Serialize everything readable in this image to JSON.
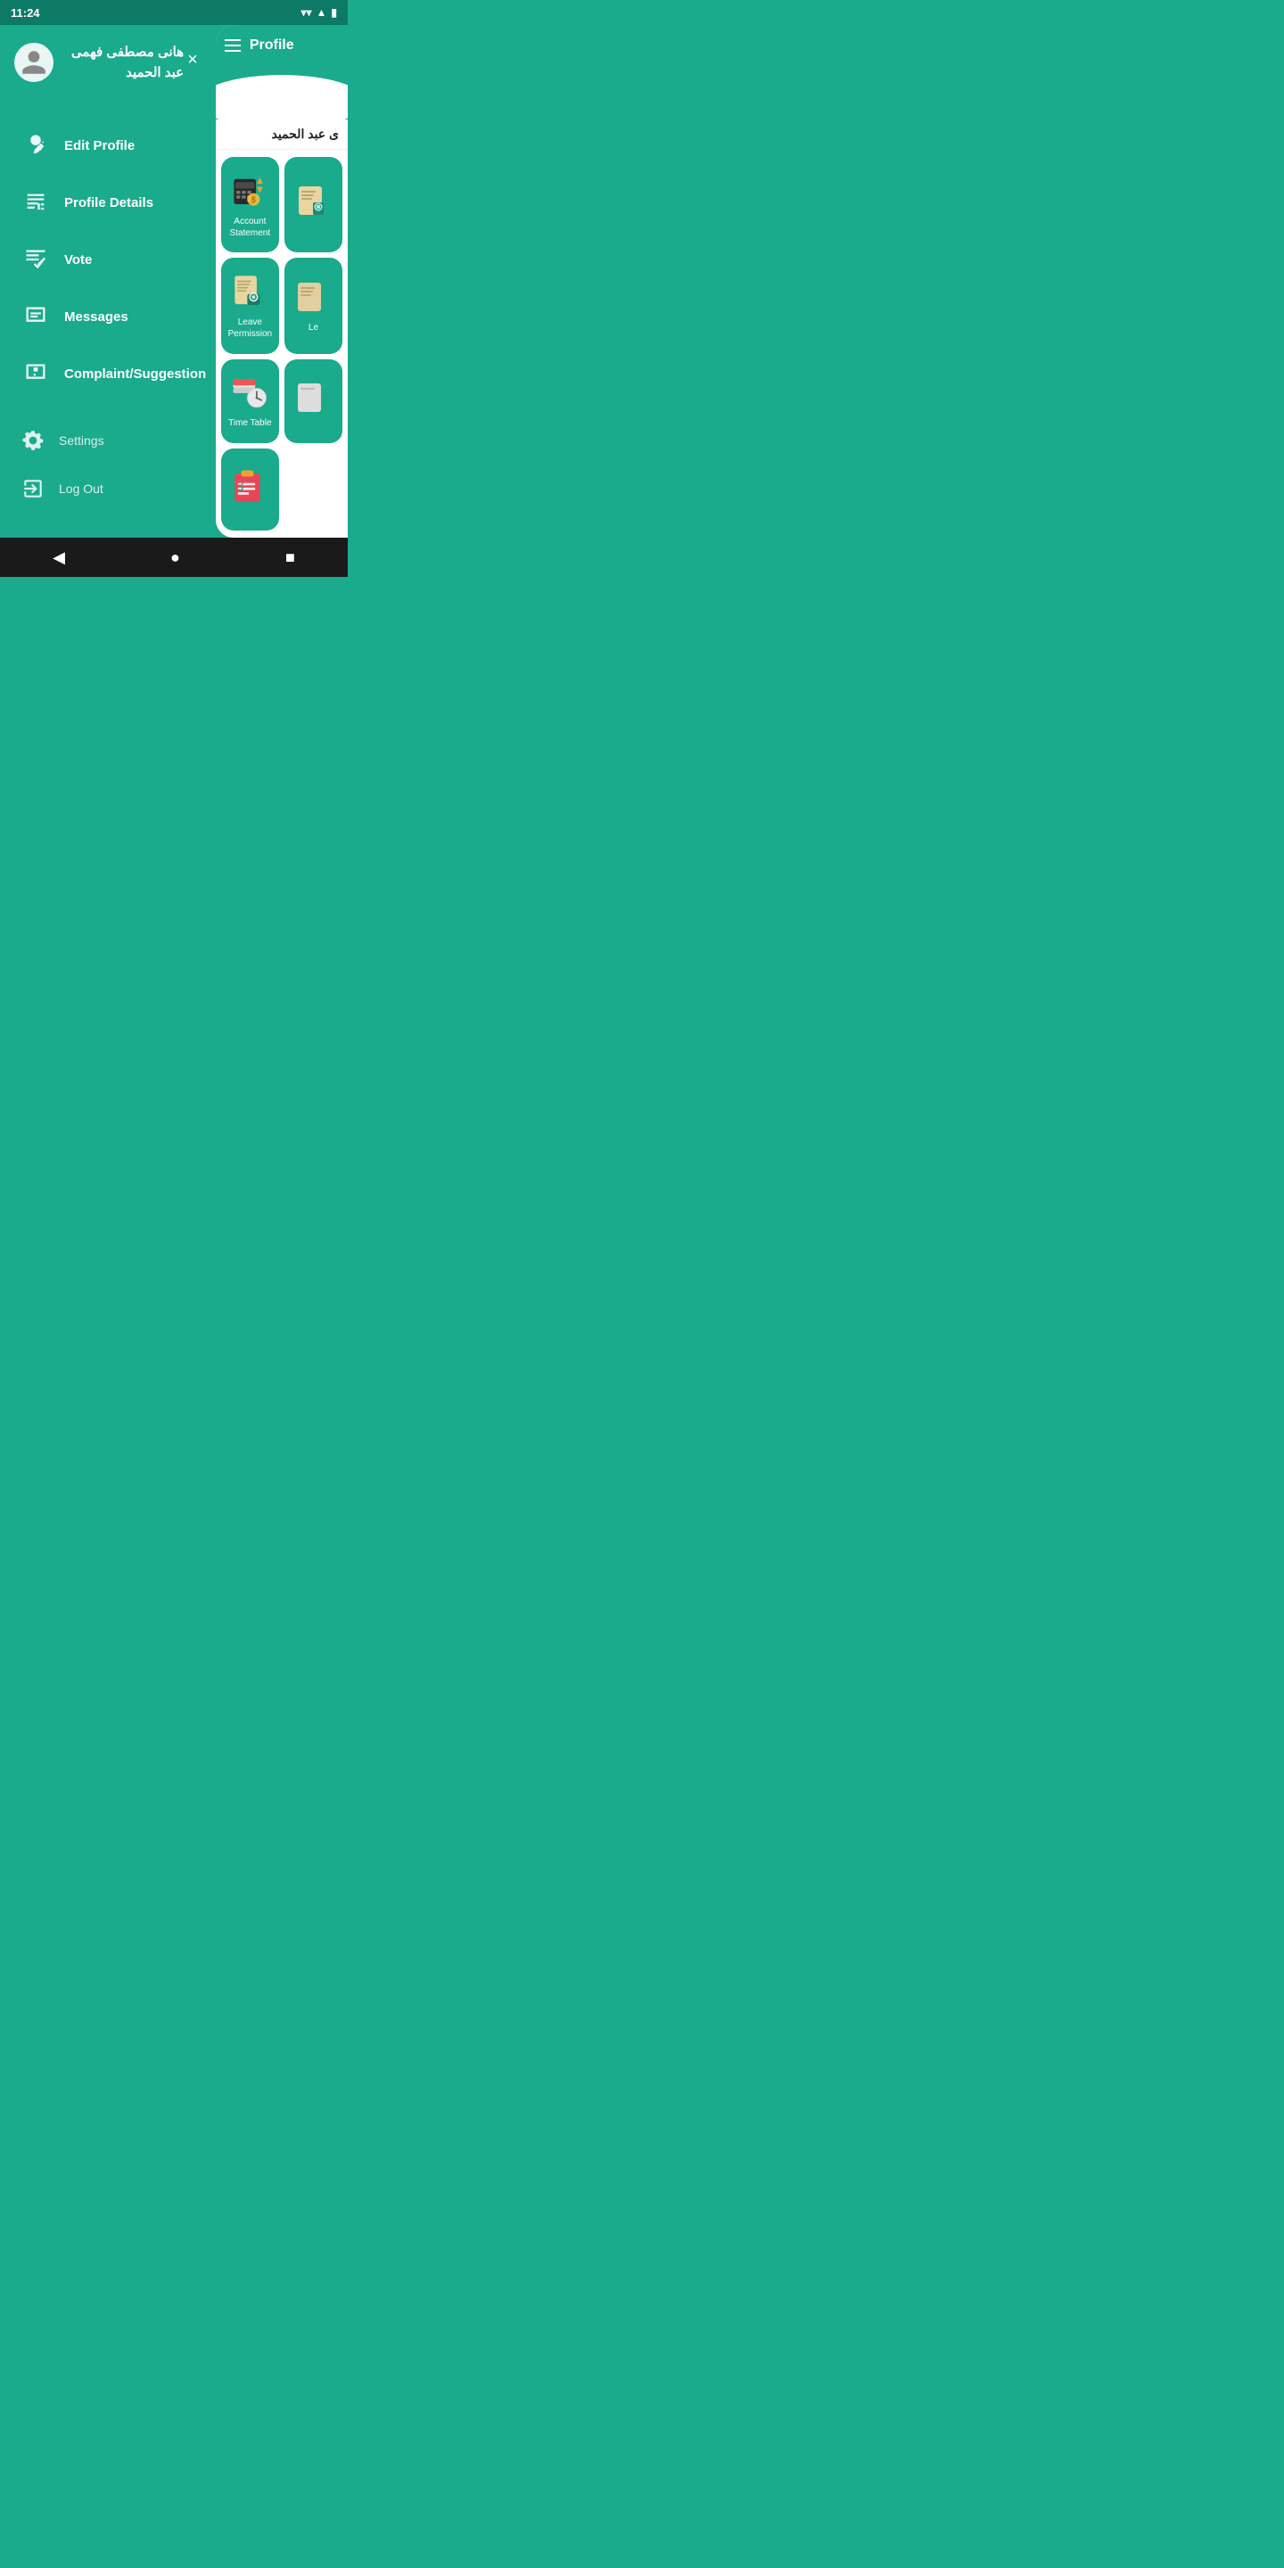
{
  "statusBar": {
    "time": "11:24",
    "icons": [
      "wifi",
      "signal",
      "battery"
    ]
  },
  "sidebar": {
    "user": {
      "name": "هانى مصطفى فهمى عبد الحميد"
    },
    "closeLabel": "×",
    "menuItems": [
      {
        "id": "edit-profile",
        "label": "Edit Profile",
        "icon": "edit-profile"
      },
      {
        "id": "profile-details",
        "label": "Profile Details",
        "icon": "profile-details"
      },
      {
        "id": "vote",
        "label": "Vote",
        "icon": "vote"
      },
      {
        "id": "messages",
        "label": "Messages",
        "icon": "messages"
      },
      {
        "id": "complaint",
        "label": "Complaint/Suggestion",
        "icon": "complaint"
      }
    ],
    "bottomItems": [
      {
        "id": "settings",
        "label": "Settings",
        "icon": "settings"
      },
      {
        "id": "logout",
        "label": "Log Out",
        "icon": "logout"
      }
    ]
  },
  "profile": {
    "title": "Profile",
    "username": "ى عبد الحميد",
    "cards": [
      {
        "id": "account-statement",
        "label": "Account\nStatement"
      },
      {
        "id": "another-card-1",
        "label": ""
      },
      {
        "id": "leave-permission",
        "label": "Leave\nPermission"
      },
      {
        "id": "another-card-2",
        "label": "Le"
      },
      {
        "id": "time-table",
        "label": "Time Table"
      },
      {
        "id": "another-card-3",
        "label": ""
      },
      {
        "id": "checklist-card",
        "label": ""
      }
    ]
  },
  "navBar": {
    "back": "◀",
    "home": "●",
    "recent": "■"
  }
}
